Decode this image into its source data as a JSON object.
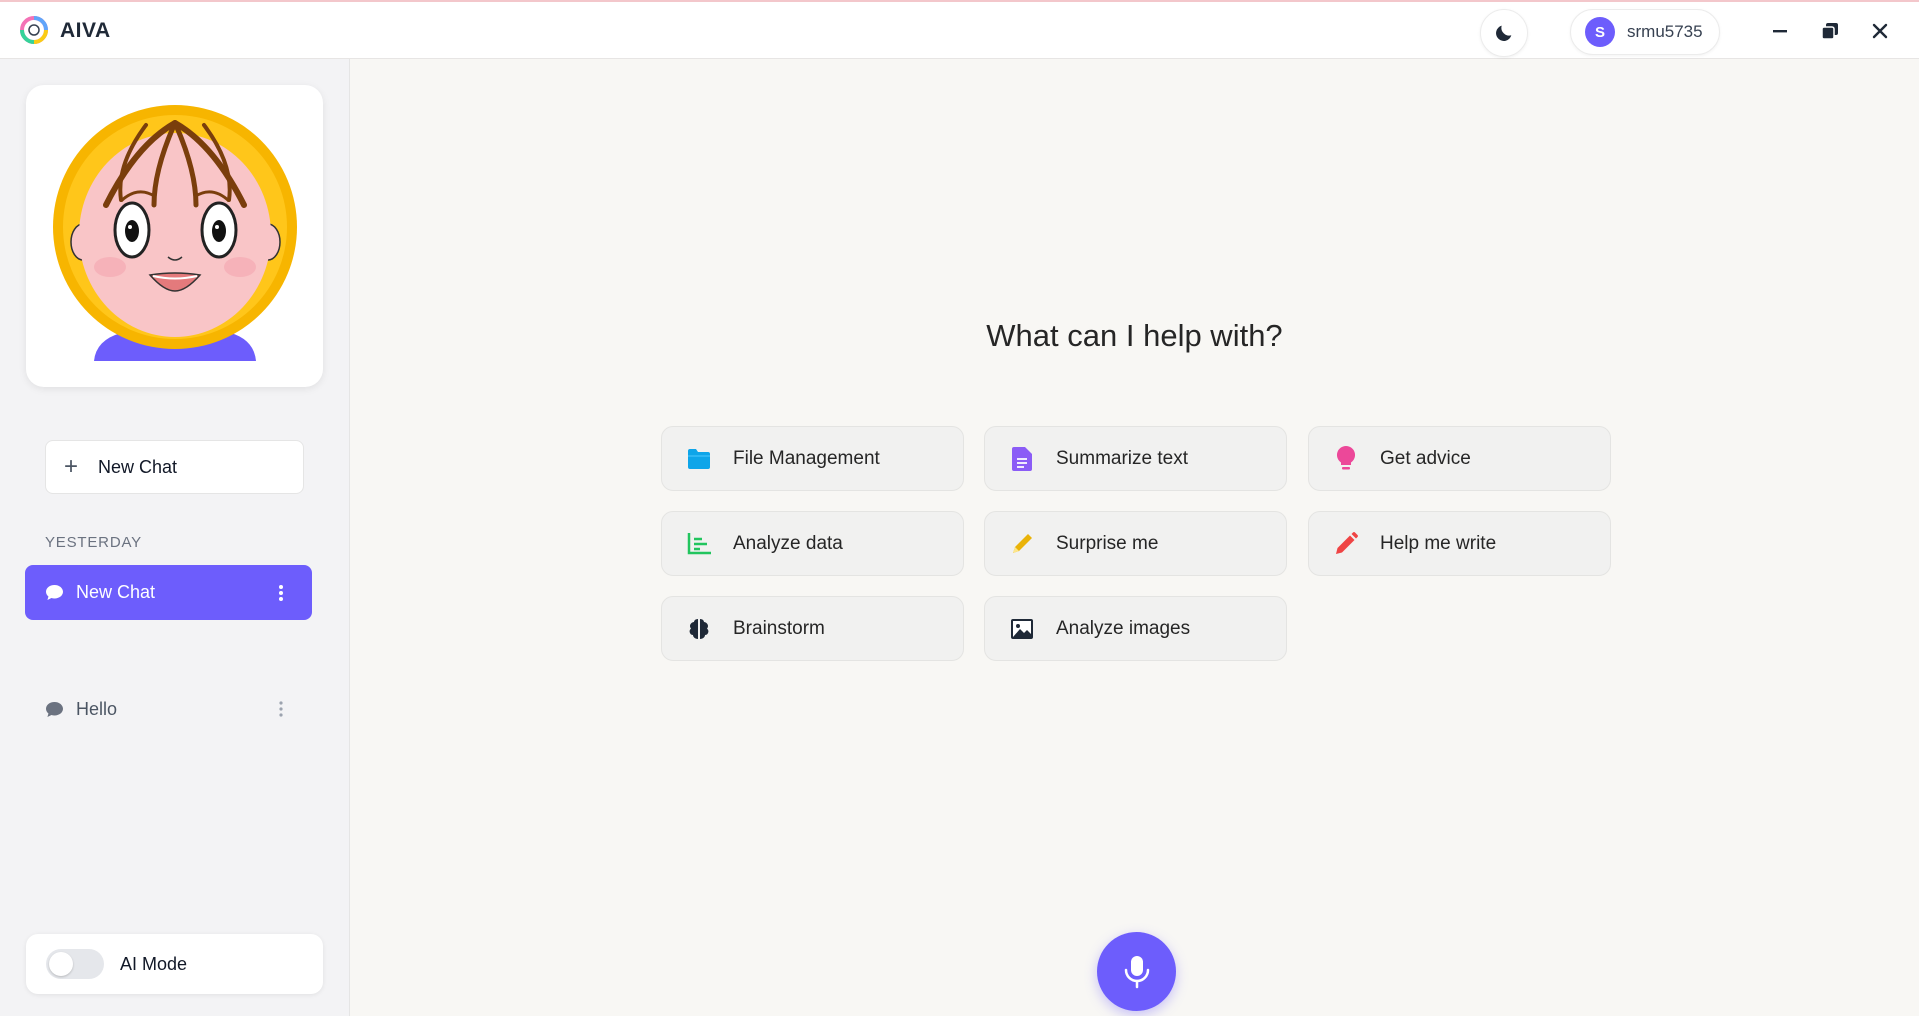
{
  "app": {
    "title": "AIVA"
  },
  "header": {
    "user_initial": "S",
    "username": "srmu5735"
  },
  "sidebar": {
    "new_chat_label": "New Chat",
    "section_label": "YESTERDAY",
    "chats": [
      {
        "label": "New Chat",
        "active": true
      },
      {
        "label": "Hello",
        "active": false
      }
    ],
    "ai_mode_label": "AI Mode",
    "ai_mode_on": false
  },
  "main": {
    "heading": "What can I help with?",
    "cards": [
      {
        "label": "File Management",
        "icon": "folder-icon",
        "color": "#0ea5e9"
      },
      {
        "label": "Summarize text",
        "icon": "document-icon",
        "color": "#8b5cf6"
      },
      {
        "label": "Get advice",
        "icon": "lightbulb-icon",
        "color": "#ec4899"
      },
      {
        "label": "Analyze data",
        "icon": "chart-icon",
        "color": "#22c55e"
      },
      {
        "label": "Surprise me",
        "icon": "pencil-icon",
        "color": "#eab308"
      },
      {
        "label": "Help me write",
        "icon": "pen-icon",
        "color": "#ef4444"
      },
      {
        "label": "Brainstorm",
        "icon": "brain-icon",
        "color": "#1f2937"
      },
      {
        "label": "Analyze images",
        "icon": "image-icon",
        "color": "#1f2937"
      }
    ]
  },
  "colors": {
    "accent": "#6d5dfc"
  }
}
